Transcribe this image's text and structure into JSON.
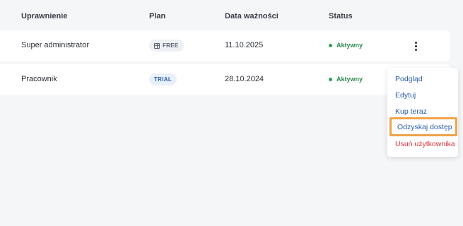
{
  "table": {
    "headers": {
      "role": "Uprawnienie",
      "plan": "Plan",
      "expiry": "Data ważności",
      "status": "Status"
    },
    "rows": [
      {
        "role": "Super administrator",
        "plan": "FREE",
        "expiry": "11.10.2025",
        "status": "Aktywny"
      },
      {
        "role": "Pracownik",
        "plan": "TRIAL",
        "expiry": "28.10.2024",
        "status": "Aktywny"
      }
    ]
  },
  "context_menu": {
    "items": [
      {
        "label": "Podgląd"
      },
      {
        "label": "Edytuj"
      },
      {
        "label": "Kup teraz"
      },
      {
        "label": "Odzyskaj dostęp"
      },
      {
        "label": "Usuń użytkownika"
      }
    ]
  },
  "colors": {
    "status_active": "#2f8a4f",
    "menu_link": "#2b5fa8",
    "menu_danger": "#e0303a",
    "highlight": "#f0a34a"
  }
}
